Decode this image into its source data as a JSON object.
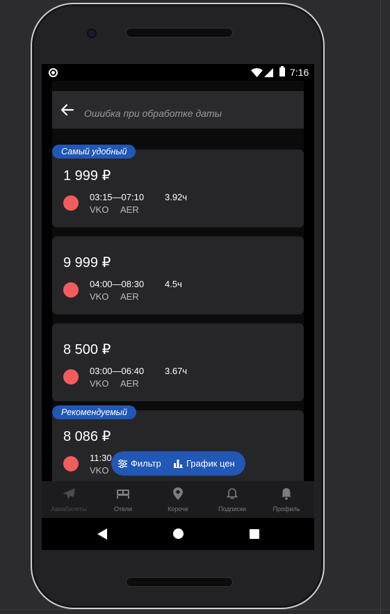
{
  "status_bar": {
    "time": "7:16",
    "icons": [
      "notification-dot-icon",
      "wifi-icon",
      "signal-icon",
      "battery-icon"
    ]
  },
  "header": {
    "back_icon": "arrow-left-icon",
    "title": "Ошибка при обработке даты"
  },
  "flights": [
    {
      "badge": "Самый удобный",
      "price": "1 999 ₽",
      "times": "03:15—07:10",
      "from": "VKO",
      "to": "AER",
      "duration": "3.92ч",
      "airline_color": "#f25c5c"
    },
    {
      "badge": "",
      "price": "9 999 ₽",
      "times": "04:00—08:30",
      "from": "VKO",
      "to": "AER",
      "duration": "4.5ч",
      "airline_color": "#f25c5c"
    },
    {
      "badge": "",
      "price": "8 500 ₽",
      "times": "03:00—06:40",
      "from": "VKO",
      "to": "AER",
      "duration": "3.67ч",
      "airline_color": "#f25c5c"
    },
    {
      "badge": "Рекомендуемый",
      "price": "8 086 ₽",
      "times": "11:30",
      "from": "VKO",
      "to": "",
      "duration": "",
      "airline_color": "#f25c5c"
    }
  ],
  "fab": {
    "filter_label": "Фильтр",
    "chart_label": "График цен",
    "filter_icon": "sliders-icon",
    "chart_icon": "bar-chart-icon"
  },
  "bottom_nav": [
    {
      "label": "Авиабилеты",
      "icon": "airplane-icon",
      "active": true
    },
    {
      "label": "Отели",
      "icon": "bed-icon",
      "active": false
    },
    {
      "label": "Короче",
      "icon": "location-pin-icon",
      "active": false
    },
    {
      "label": "Подписки",
      "icon": "bell-outline-icon",
      "active": false
    },
    {
      "label": "Профиль",
      "icon": "bell-icon",
      "active": false
    }
  ],
  "android_nav": [
    "back-triangle-icon",
    "home-circle-icon",
    "recents-square-icon"
  ],
  "colors": {
    "accent": "#2157b5",
    "card": "#262629",
    "airline_dot": "#f25c5c",
    "background": "#0b0b0b"
  }
}
